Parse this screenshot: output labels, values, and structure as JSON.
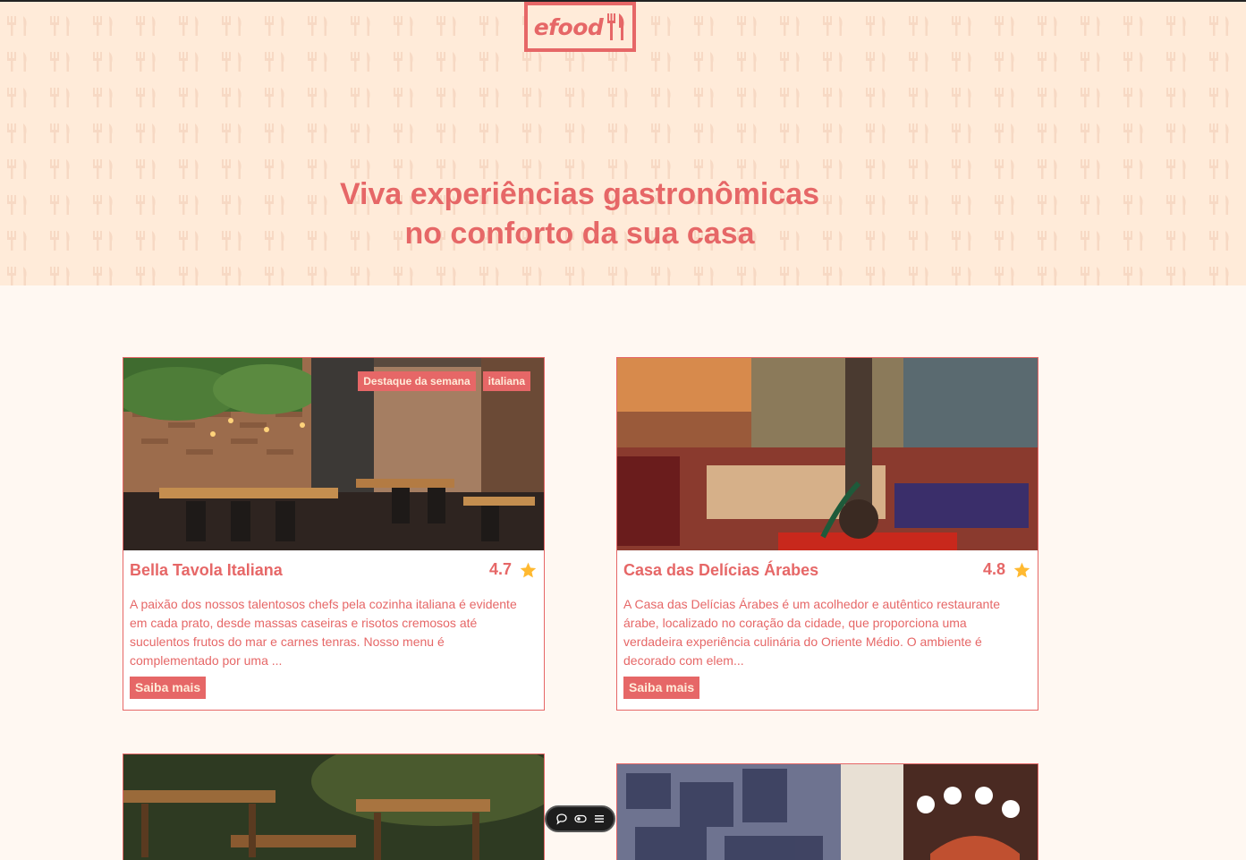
{
  "brand": {
    "logo_text": "efood"
  },
  "hero": {
    "title_line1": "Viva experiências gastronômicas",
    "title_line2": "no conforto da sua casa"
  },
  "colors": {
    "primary": "#e66767",
    "hero_bg": "#ffebd9",
    "page_bg": "#fff8f2",
    "star": "#ffb930"
  },
  "restaurants": [
    {
      "name": "Bella Tavola Italiana",
      "rating": "4.7",
      "tags": [
        "Destaque da semana",
        "italiana"
      ],
      "description": "A paixão dos nossos talentosos chefs pela cozinha italiana é evidente em cada prato, desde massas caseiras e risotos cremosos até suculentos frutos do mar e carnes tenras. Nosso menu é complementado por uma ...",
      "button": "Saiba mais"
    },
    {
      "name": "Casa das Delícias Árabes",
      "rating": "4.8",
      "tags": [],
      "description": "A Casa das Delícias Árabes é um acolhedor e autêntico restaurante árabe, localizado no coração da cidade, que proporciona uma verdadeira experiência culinária do Oriente Médio. O ambiente é decorado com elem...",
      "button": "Saiba mais"
    }
  ],
  "floating_toolbar": {
    "icons": [
      "chat-icon",
      "toggle-icon",
      "menu-icon"
    ]
  }
}
